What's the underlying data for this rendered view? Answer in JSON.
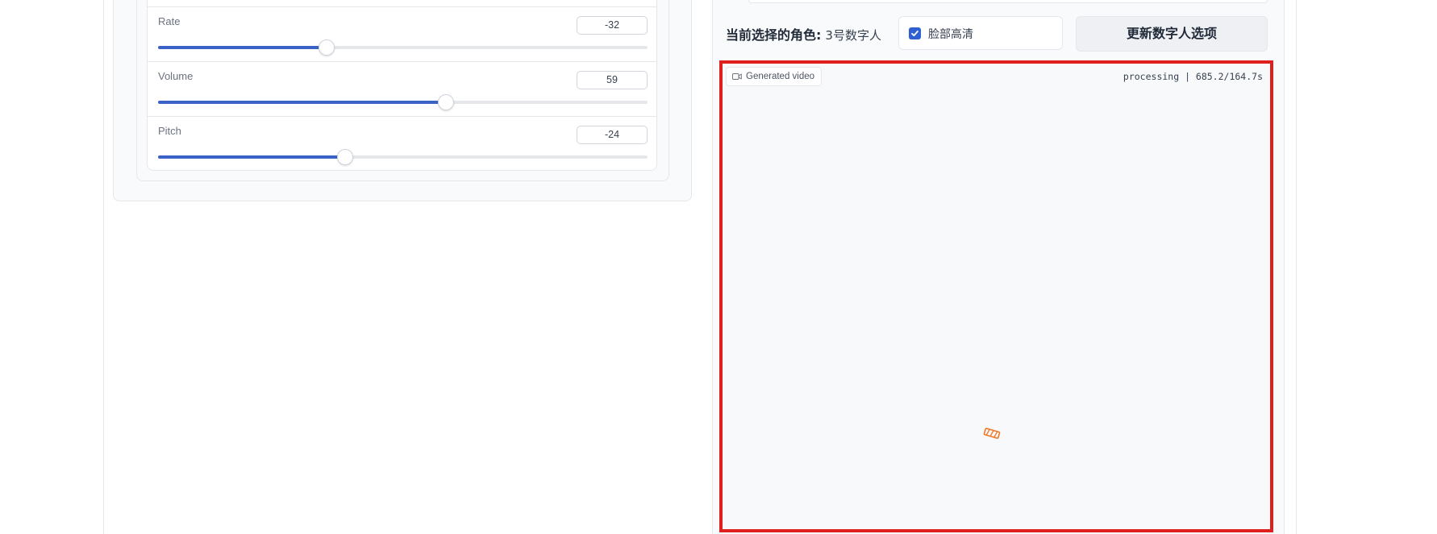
{
  "sliders": [
    {
      "label": "Rate",
      "value": "-32",
      "fraction": 0.345
    },
    {
      "label": "Volume",
      "value": "59",
      "fraction": 0.588
    },
    {
      "label": "Pitch",
      "value": "-24",
      "fraction": 0.383
    }
  ],
  "role": {
    "label": "当前选择的角色:",
    "value": "3号数字人"
  },
  "face_hd": {
    "label": "脸部高清",
    "checked": true
  },
  "update_button": {
    "label": "更新数字人选项"
  },
  "video": {
    "tag": "Generated video",
    "status": "processing | 685.2/164.7s"
  },
  "colors": {
    "accent": "#3b62c6",
    "highlight_border": "#e0201e",
    "spinner": "#f07a2a"
  },
  "icons": {
    "video_tag": "video-camera-icon",
    "checkbox": "checkmark-icon",
    "loading": "loading-spinner-icon"
  }
}
